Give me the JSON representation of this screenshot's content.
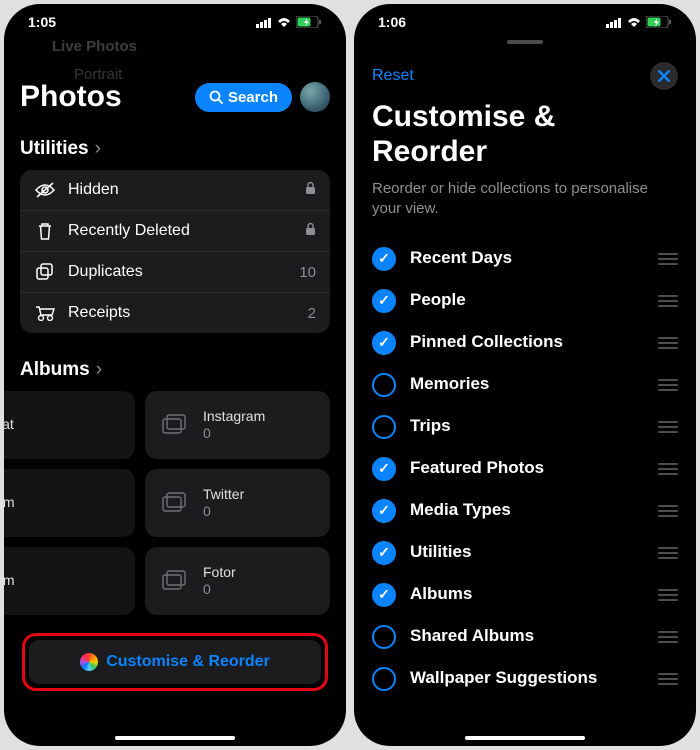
{
  "left": {
    "time": "1:05",
    "ghost_top": "Live Photos",
    "ghost_back": "Portrait",
    "title": "Photos",
    "search_label": "Search",
    "utilities_header": "Utilities",
    "utilities": [
      {
        "icon": "eye-slash",
        "label": "Hidden",
        "trail_icon": "lock"
      },
      {
        "icon": "trash",
        "label": "Recently Deleted",
        "trail_icon": "lock"
      },
      {
        "icon": "duplicate",
        "label": "Duplicates",
        "trail": "10"
      },
      {
        "icon": "receipt",
        "label": "Receipts",
        "trail": "2"
      }
    ],
    "albums_header": "Albums",
    "albums": [
      {
        "left_cut": true,
        "label": "napchat"
      },
      {
        "label": "Instagram",
        "count": "0"
      },
      {
        "left_cut": true,
        "label": "stagram"
      },
      {
        "label": "Twitter",
        "count": "0"
      },
      {
        "left_cut": true,
        "label": "stagram"
      },
      {
        "label": "Fotor",
        "count": "0"
      }
    ],
    "customise_label": "Customise & Reorder"
  },
  "right": {
    "time": "1:06",
    "reset": "Reset",
    "title": "Customise & Reorder",
    "subtitle": "Reorder or hide collections to personalise your view.",
    "items": [
      {
        "label": "Recent Days",
        "on": true
      },
      {
        "label": "People",
        "on": true
      },
      {
        "label": "Pinned Collections",
        "on": true
      },
      {
        "label": "Memories",
        "on": false
      },
      {
        "label": "Trips",
        "on": false
      },
      {
        "label": "Featured Photos",
        "on": true
      },
      {
        "label": "Media Types",
        "on": true
      },
      {
        "label": "Utilities",
        "on": true
      },
      {
        "label": "Albums",
        "on": true
      },
      {
        "label": "Shared Albums",
        "on": false
      },
      {
        "label": "Wallpaper Suggestions",
        "on": false
      }
    ]
  }
}
